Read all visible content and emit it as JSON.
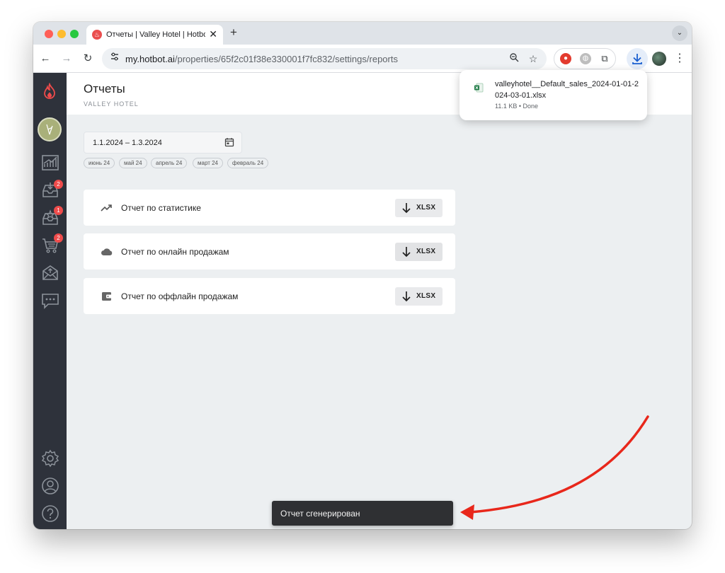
{
  "browser": {
    "tab_title": "Отчеты | Valley Hotel | Hotbot",
    "url_host": "my.hotbot.ai",
    "url_path": "/properties/65f2c01f38e330001f7fc832/settings/reports"
  },
  "download": {
    "filename": "valleyhotel__Default_sales_2024-01-01-2024-03-01.xlsx",
    "size": "11.1 KB",
    "status": "Done",
    "meta": "11.1 KB • Done"
  },
  "page": {
    "title": "Отчеты",
    "subtitle": "VALLEY HOTEL"
  },
  "date_range": {
    "value": "1.1.2024 – 1.3.2024",
    "presets": [
      "июнь 24",
      "май 24",
      "апрель 24",
      "март 24",
      "февраль 24"
    ]
  },
  "reports": [
    {
      "label": "Отчет по статистике",
      "icon": "trending-up-icon",
      "button": "XLSX"
    },
    {
      "label": "Отчет по онлайн продажам",
      "icon": "cloud-icon",
      "button": "XLSX"
    },
    {
      "label": "Отчет по оффлайн продажам",
      "icon": "wallet-icon",
      "button": "XLSX"
    }
  ],
  "sidebar": {
    "badges": {
      "inbox": "2",
      "reviews": "1",
      "cart": "2"
    }
  },
  "snackbar": {
    "message": "Отчет сгенерирован"
  },
  "colors": {
    "sidebar": "#2e323b",
    "badge": "#ef4b4b",
    "annotation_arrow": "#e8271b",
    "content_bg": "#eceff1"
  }
}
